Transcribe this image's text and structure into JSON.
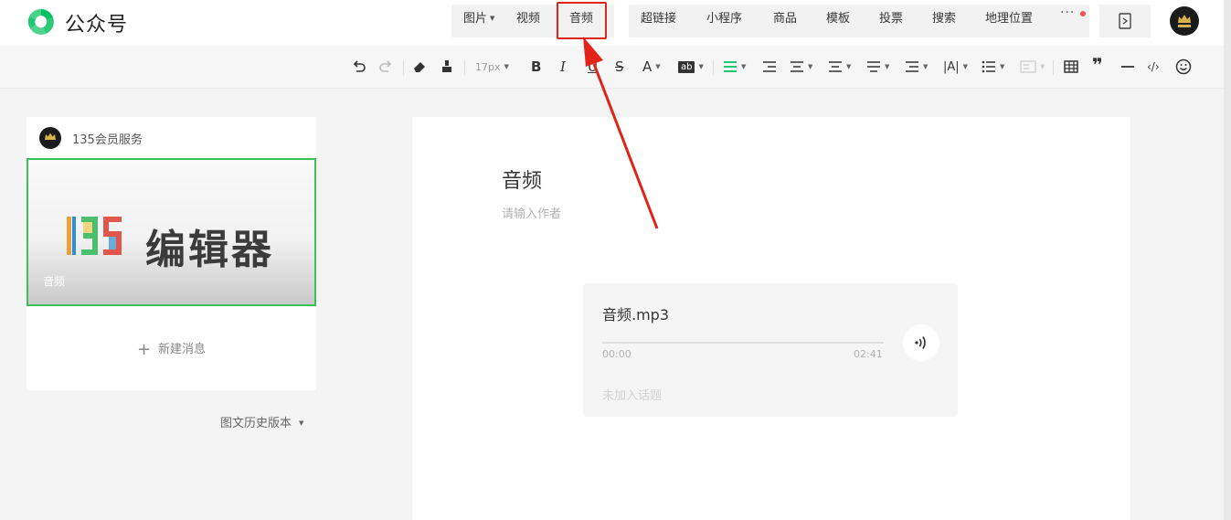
{
  "header": {
    "app_title": "公众号",
    "nav_group_one": [
      {
        "label": "图片",
        "has_dropdown": true
      },
      {
        "label": "视频",
        "has_dropdown": false
      },
      {
        "label": "音频",
        "has_dropdown": false
      }
    ],
    "nav_group_two": [
      {
        "label": "超链接"
      },
      {
        "label": "小程序"
      },
      {
        "label": "商品"
      },
      {
        "label": "模板"
      },
      {
        "label": "投票"
      },
      {
        "label": "搜索"
      },
      {
        "label": "地理位置"
      }
    ],
    "more_icon": "more-dots-icon",
    "preview_icon": "phone-preview-icon",
    "highlight_color": "#e2231a"
  },
  "toolbar": {
    "font_size": "17px",
    "bold": "B",
    "italic": "I",
    "underline": "U",
    "strike": "S",
    "font_color": "A",
    "bg_color": "ab",
    "accent": "#07c160"
  },
  "sidebar": {
    "account_name": "135会员服务",
    "cover_title": "编辑器",
    "cover_label": "音频",
    "new_message": "新建消息",
    "history": "图文历史版本",
    "accent": "#3cc15a"
  },
  "editor": {
    "title": "音频",
    "author_placeholder": "请输入作者",
    "audio": {
      "file_name": "音频.mp3",
      "current_time": "00:00",
      "duration": "02:41",
      "progress": 0,
      "topic": "未加入话题"
    }
  }
}
